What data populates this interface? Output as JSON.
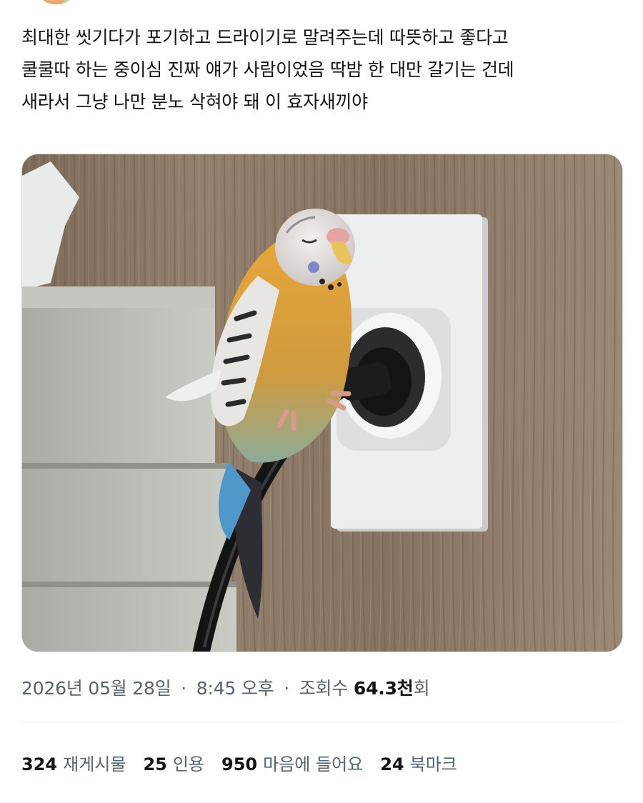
{
  "tweet": {
    "text": "최대한 씻기다가 포기하고 드라이기로 말려주는데 따뜻하고 좋다고\n쿨쿨따 하는 중이심 진짜 얘가 사람이었음 딱밤 한 대만 갈기는 건데\n새라서 그냥 나만 분노 삭혀야 돼 이 효자새끼야"
  },
  "meta": {
    "date": "2026년 05월 28일",
    "separator": "·",
    "time": "8:45 오후",
    "views_label_prefix": "조회수",
    "views_count": "64.3천",
    "views_label_suffix": "회"
  },
  "stats": [
    {
      "count": "324",
      "label": "재게시물"
    },
    {
      "count": "25",
      "label": "인용"
    },
    {
      "count": "950",
      "label": "마음에 들어요"
    },
    {
      "count": "24",
      "label": "북마크"
    }
  ],
  "colors": {
    "text": "#0f1419",
    "secondary": "#536471",
    "divider": "#eff3f4"
  }
}
